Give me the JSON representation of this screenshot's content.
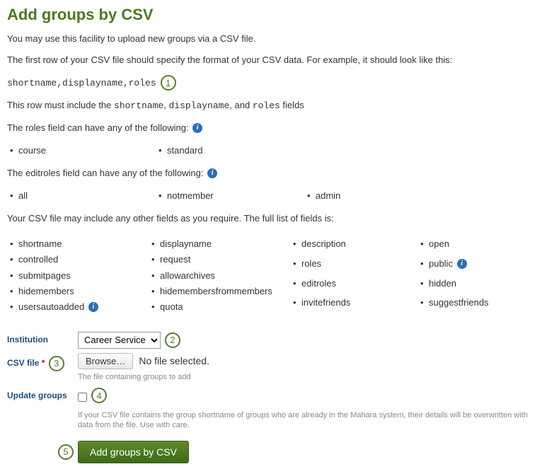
{
  "title": "Add groups by CSV",
  "intro": "You may use this facility to upload new groups via a CSV file.",
  "first_row_intro": "The first row of your CSV file should specify the format of your CSV data. For example, it should look like this:",
  "csv_header_example": "shortname,displayname,roles",
  "mandatory_prefix": "This row must include the ",
  "mandatory_fields": [
    "shortname",
    "displayname",
    "roles"
  ],
  "mandatory_joiner": ", ",
  "mandatory_last_joiner": ", and ",
  "mandatory_suffix": " fields",
  "roles_intro": "The roles field can have any of the following:",
  "roles_values": [
    "course",
    "standard"
  ],
  "editroles_intro": "The editroles field can have any of the following:",
  "editroles_values": [
    "all",
    "notmember",
    "admin"
  ],
  "full_list_intro": "Your CSV file may include any other fields as you require. The full list of fields is:",
  "all_fields_col1": [
    "shortname",
    "controlled",
    "submitpages",
    "hidemembers",
    "usersautoadded"
  ],
  "all_fields_col2": [
    "displayname",
    "request",
    "allowarchives",
    "hidemembersfrommembers",
    "quota"
  ],
  "all_fields_col3": [
    "description",
    "roles",
    "editroles",
    "invitefriends"
  ],
  "all_fields_col4": [
    "open",
    "public",
    "hidden",
    "suggestfriends"
  ],
  "info_fields": [
    "usersautoadded",
    "public"
  ],
  "annotations": {
    "1": "1",
    "2": "2",
    "3": "3",
    "4": "4",
    "5": "5"
  },
  "form": {
    "institution": {
      "label": "Institution",
      "value": "Career Service"
    },
    "csvfile": {
      "label": "CSV file",
      "required": "*",
      "browse": "Browse…",
      "status": "No file selected.",
      "help": "The file containing groups to add"
    },
    "update": {
      "label": "Update groups",
      "checked": false,
      "help": "If your CSV file contains the group shortname of groups who are already in the Mahara system, their details will be overwritten with data from the file. Use with care."
    },
    "submit": "Add groups by CSV"
  }
}
